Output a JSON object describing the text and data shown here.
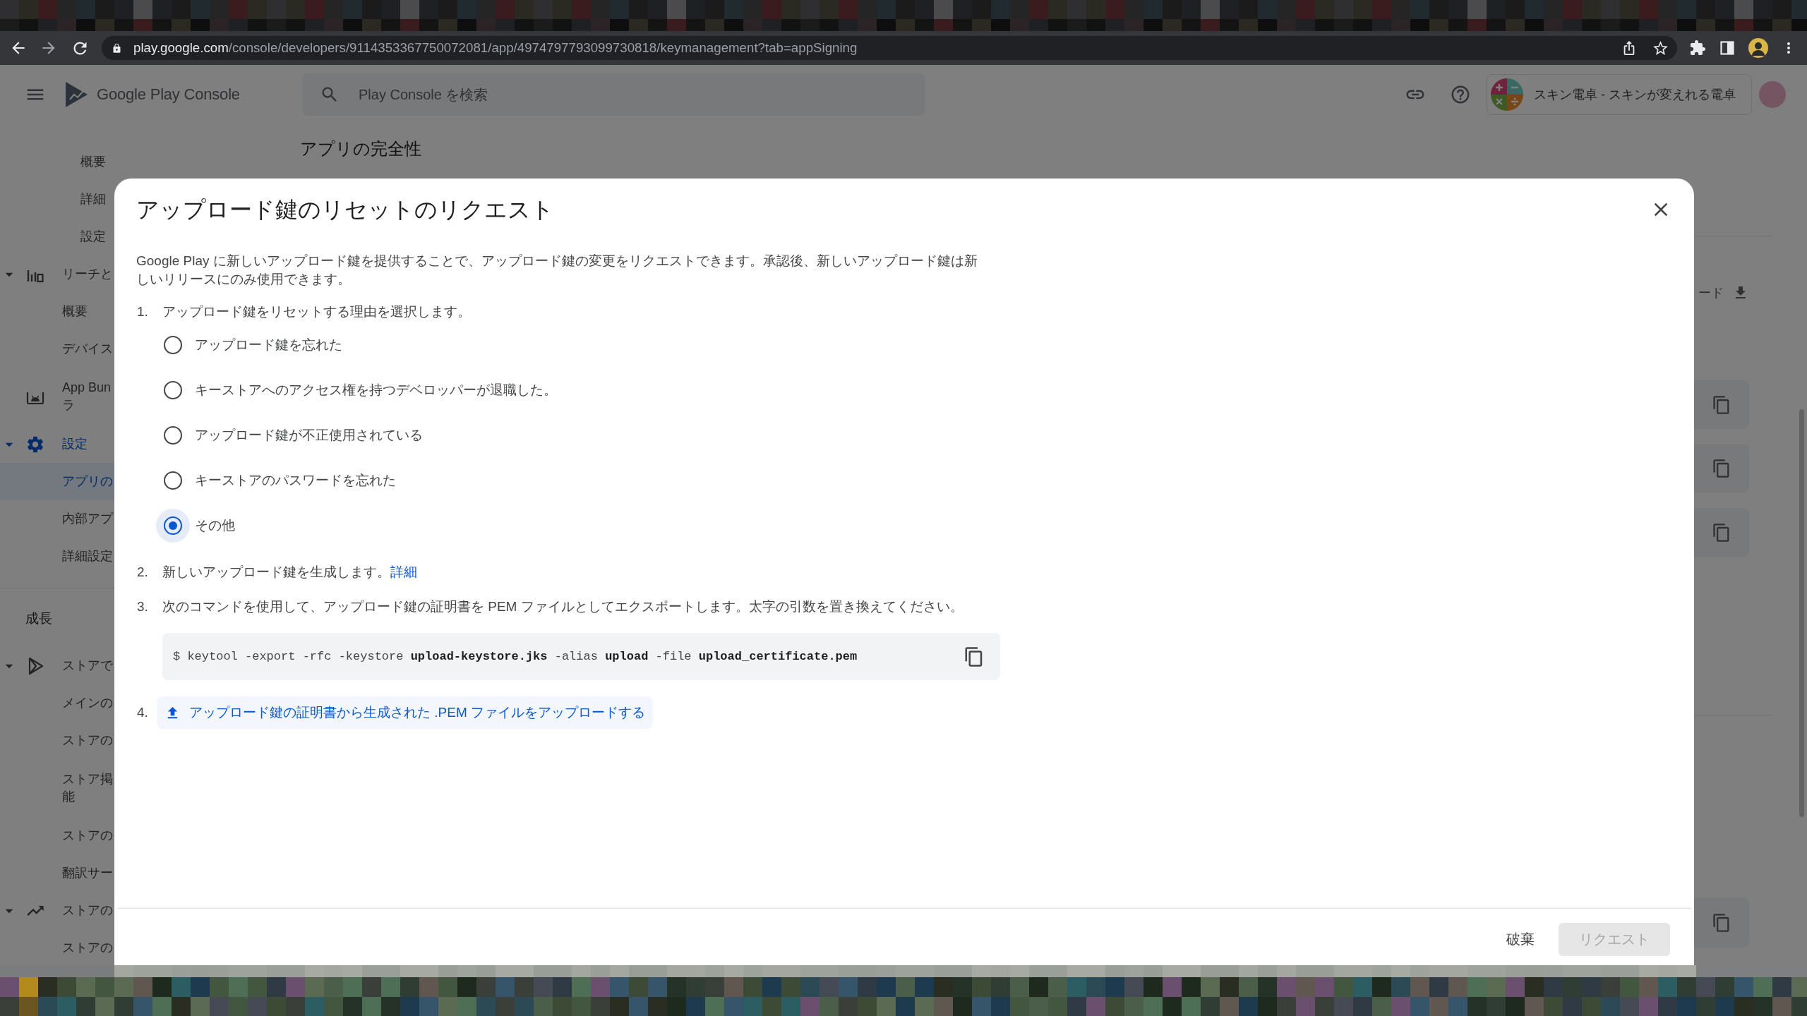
{
  "browser": {
    "url": {
      "host": "play.google.com",
      "path": "/console/developers/9114353367750072081/app/4974797793099730818/keymanagement?tab=appSigning"
    }
  },
  "header": {
    "product": "Google Play Console",
    "search": {
      "placeholder": "Play Console を検索"
    },
    "app": {
      "name": "スキン電卓 - スキンが変えれる電卓"
    }
  },
  "sidebar": {
    "items": [
      {
        "kind": "nested",
        "children": [
          {
            "label": "概要",
            "selected": false
          },
          {
            "label": "詳細",
            "selected": false
          },
          {
            "label": "設定",
            "selected": false
          }
        ]
      },
      {
        "kind": "group",
        "label": "リーチと",
        "expanded": true,
        "selected": false,
        "children": [
          {
            "label": "概要",
            "selected": false
          },
          {
            "label": "デバイス",
            "selected": false
          }
        ]
      },
      {
        "kind": "link",
        "lines": [
          "App Bun",
          "ラ"
        ],
        "selected": false
      },
      {
        "kind": "group",
        "label": "設定",
        "expanded": true,
        "selected": false,
        "children": [
          {
            "label": "アプリの",
            "selected": true
          },
          {
            "label": "内部アプ",
            "selected": false
          },
          {
            "label": "詳細設定",
            "selected": false
          }
        ]
      },
      {
        "kind": "heading",
        "label": "成長"
      },
      {
        "kind": "group",
        "label": "ストアで",
        "expanded": true,
        "selected": false,
        "children": [
          {
            "label": "メインの",
            "selected": false
          },
          {
            "label": "ストアの",
            "selected": false
          },
          {
            "lines": [
              "ストア掲",
              "能"
            ],
            "selected": false
          },
          {
            "label": "ストアの",
            "selected": false
          },
          {
            "label": "翻訳サー",
            "selected": false
          }
        ]
      },
      {
        "kind": "group",
        "label": "ストアの",
        "expanded": true,
        "selected": false,
        "children": [
          {
            "label": "ストアの",
            "selected": false
          }
        ]
      }
    ]
  },
  "page": {
    "title": "アプリの完全性",
    "fragment": "ード"
  },
  "dialog": {
    "title": "アップロード鍵のリセットのリクエスト",
    "description": "Google Play に新しいアップロード鍵を提供することで、アップロード鍵の変更をリクエストできます。承認後、新しいアップロード鍵は新しいリリースにのみ使用できます。",
    "steps": [
      {
        "kind": "choice",
        "number": "1.",
        "text": "アップロード鍵をリセットする理由を選択します。",
        "options": [
          {
            "label": "アップロード鍵を忘れた",
            "selected": false
          },
          {
            "label": "キーストアへのアクセス権を持つデベロッパーが退職した。",
            "selected": false
          },
          {
            "label": "アップロード鍵が不正使用されている",
            "selected": false
          },
          {
            "label": "キーストアのパスワードを忘れた",
            "selected": false
          },
          {
            "label": "その他",
            "selected": true
          }
        ]
      },
      {
        "kind": "text",
        "number": "2.",
        "text": "新しいアップロード鍵を生成します。",
        "link": "詳細"
      },
      {
        "kind": "code",
        "number": "3.",
        "text": "次のコマンドを使用して、アップロード鍵の証明書を PEM ファイルとしてエクスポートします。太字の引数を置き換えてください。",
        "command": "$ keytool -export -rfc -keystore **upload-keystore.jks** -alias **upload** -file **upload_certificate.pem**"
      },
      {
        "kind": "upload",
        "number": "4.",
        "button": "アップロード鍵の証明書から生成された .PEM ファイルをアップロードする"
      }
    ],
    "actions": [
      {
        "kind": "text",
        "label": "破棄",
        "disabled": false
      },
      {
        "kind": "filled",
        "label": "リクエスト",
        "disabled": true
      }
    ]
  }
}
